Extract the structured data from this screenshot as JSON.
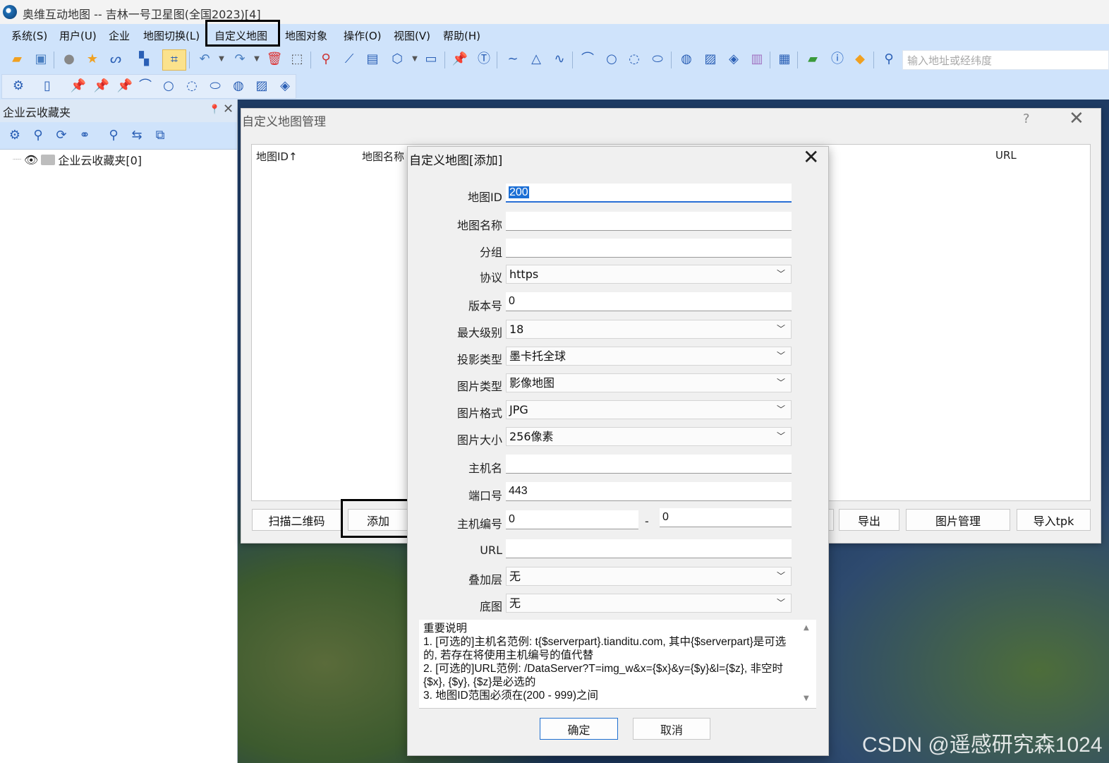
{
  "window": {
    "title": "奥维互动地图 -- 吉林一号卫星图(全国2023)[4]"
  },
  "menu": [
    "系统(S)",
    "用户(U)",
    "企业",
    "地图切换(L)",
    "自定义地图",
    "地图对象",
    "操作(O)",
    "视图(V)",
    "帮助(H)"
  ],
  "search": {
    "placeholder": "输入地址或经纬度"
  },
  "left_panel": {
    "title": "企业云收藏夹",
    "tree_item": "企业云收藏夹[0]"
  },
  "manager": {
    "title": "自定义地图管理",
    "help": "?",
    "columns": [
      "地图ID↑",
      "地图名称",
      "URL"
    ],
    "buttons": {
      "scan": "扫描二维码",
      "add": "添加",
      "export": "导出",
      "image_manage": "图片管理",
      "import_tpk": "导入tpk"
    }
  },
  "add_dialog": {
    "title": "自定义地图[添加]",
    "fields": {
      "map_id": {
        "label": "地图ID",
        "value": "200"
      },
      "map_name": {
        "label": "地图名称",
        "value": ""
      },
      "group": {
        "label": "分组",
        "value": ""
      },
      "protocol": {
        "label": "协议",
        "value": "https"
      },
      "version": {
        "label": "版本号",
        "value": "0"
      },
      "max_level": {
        "label": "最大级别",
        "value": "18"
      },
      "projection": {
        "label": "投影类型",
        "value": "墨卡托全球"
      },
      "image_type": {
        "label": "图片类型",
        "value": "影像地图"
      },
      "image_format": {
        "label": "图片格式",
        "value": "JPG"
      },
      "image_size": {
        "label": "图片大小",
        "value": "256像素"
      },
      "host": {
        "label": "主机名",
        "value": ""
      },
      "port": {
        "label": "端口号",
        "value": "443"
      },
      "host_index": {
        "label": "主机编号",
        "value_from": "0",
        "value_to": "0",
        "separator": "-"
      },
      "url": {
        "label": "URL",
        "value": ""
      },
      "overlay": {
        "label": "叠加层",
        "value": "无"
      },
      "base_map": {
        "label": "底图",
        "value": "无"
      }
    },
    "notes": "重要说明\n1. [可选的]主机名范例: t{$serverpart}.tianditu.com, 其中{$serverpart}是可选的, 若存在将使用主机编号的值代替\n2. [可选的]URL范例: /DataServer?T=img_w&x={$x}&y={$y}&l={$z}, 非空时{$x}, {$y}, {$z}是必选的\n3. 地图ID范围必须在(200 - 999)之间",
    "ok": "确定",
    "cancel": "取消"
  },
  "watermark": "CSDN @遥感研究森1024",
  "colors": {
    "menubar": "#cfe3fb",
    "accent": "#1f6fd0"
  }
}
